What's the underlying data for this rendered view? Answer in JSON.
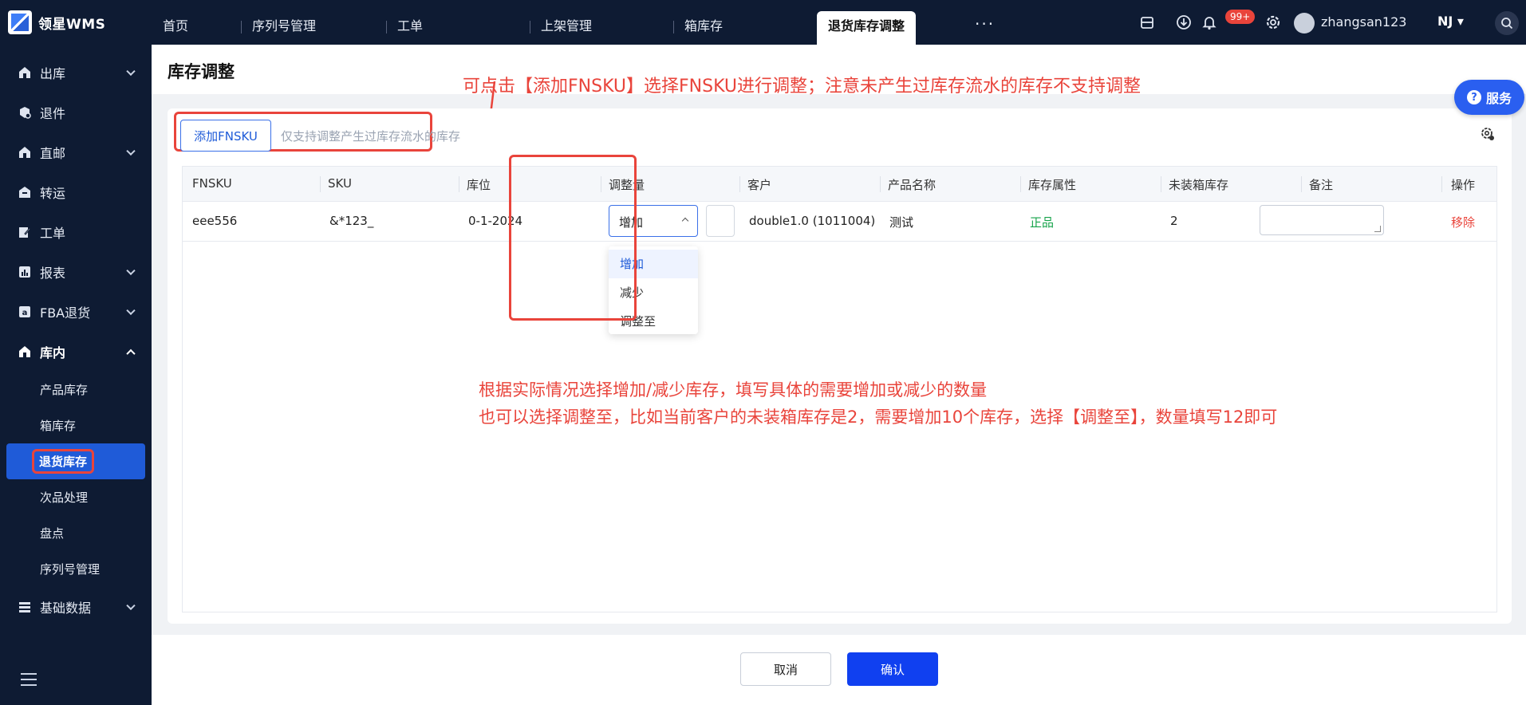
{
  "app": {
    "logo_text": "领星WMS"
  },
  "sidebar": {
    "items": [
      {
        "label": "出库",
        "icon": "home-icon",
        "has_children": true
      },
      {
        "label": "退件",
        "icon": "return-icon",
        "has_children": false
      },
      {
        "label": "直邮",
        "icon": "home-icon",
        "has_children": true
      },
      {
        "label": "转运",
        "icon": "transfer-icon",
        "has_children": false
      },
      {
        "label": "工单",
        "icon": "edit-icon",
        "has_children": false
      },
      {
        "label": "报表",
        "icon": "report-icon",
        "has_children": true
      },
      {
        "label": "FBA退货",
        "icon": "amazon-icon",
        "has_children": true
      },
      {
        "label": "库内",
        "icon": "home-icon",
        "has_children": true,
        "open": true
      },
      {
        "label": "基础数据",
        "icon": "grid-icon",
        "has_children": true
      }
    ],
    "sub_items": [
      "产品库存",
      "箱库存",
      "退货库存",
      "次品处理",
      "盘点",
      "序列号管理"
    ],
    "active_sub": "退货库存"
  },
  "topbar": {
    "tabs": [
      "首页",
      "序列号管理",
      "工单",
      "上架管理",
      "箱库存",
      "退货库存调整"
    ],
    "active_tab": "退货库存调整",
    "notification_count": "99+",
    "username": "zhangsan123",
    "warehouse": "NJ"
  },
  "page": {
    "title": "库存调整",
    "annotation_top": "可点击【添加FNSKU】选择FNSKU进行调整；注意未产生过库存流水的库存不支持调整",
    "add_button": "添加FNSKU",
    "add_hint": "仅支持调整产生过库存流水的库存",
    "annotation_mid": [
      "根据实际情况选择增加/减少库存，填写具体的需要增加或减少的数量",
      "也可以选择调整至，比如当前客户的未装箱库存是2，需要增加10个库存，选择【调整至】，数量填写12即可"
    ]
  },
  "table": {
    "columns": [
      "FNSKU",
      "SKU",
      "库位",
      "调整量",
      "客户",
      "产品名称",
      "库存属性",
      "未装箱库存",
      "备注",
      "操作"
    ],
    "rows": [
      {
        "fnsku": "eee556",
        "sku": "&*123_",
        "location": "0-1-2024",
        "adjust_type": "增加",
        "adjust_qty": "",
        "customer": "double1.0 (1011004)",
        "product_name": "测试",
        "stock_attr": "正品",
        "unboxed_stock": "2",
        "remark": "",
        "action": "移除"
      }
    ],
    "adjust_options": [
      "增加",
      "减少",
      "调整至"
    ],
    "selected_option": "增加"
  },
  "footer": {
    "cancel": "取消",
    "confirm": "确认"
  },
  "service_button": "服务",
  "colors": {
    "sidebar_bg": "#0e1b33",
    "primary": "#1040f0",
    "annotation_red": "#e9443b",
    "success_green": "#16a34a"
  }
}
